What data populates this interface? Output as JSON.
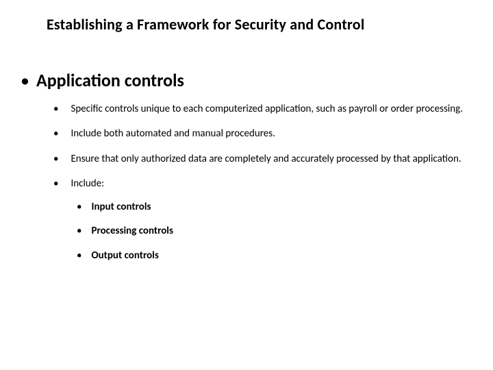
{
  "title": "Establishing a Framework for Security and Control",
  "heading": "Application controls",
  "bullets": {
    "b1": "Specific controls unique to each computerized application, such as payroll or order processing.",
    "b2": "Include both automated and manual procedures.",
    "b3": "Ensure that only authorized data are completely and accurately processed by that application.",
    "b4": "Include:"
  },
  "sub_bullets": {
    "s1": "Input controls",
    "s2": "Processing controls",
    "s3": "Output controls"
  },
  "glyphs": {
    "bullet": "•"
  }
}
